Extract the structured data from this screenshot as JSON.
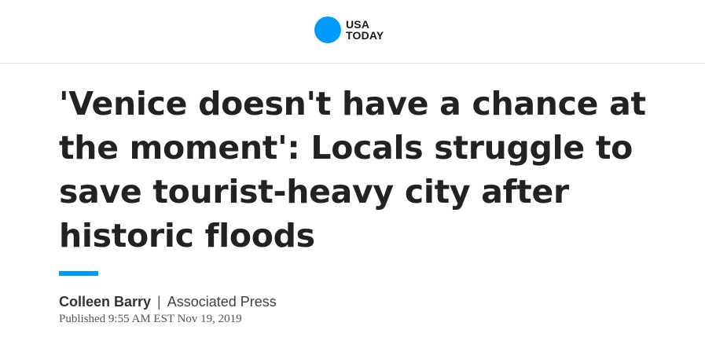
{
  "brand": {
    "name_line1": "USA",
    "name_line2": "TODAY",
    "logo_color": "#009bff",
    "icon": "usa-today-dot-logo"
  },
  "article": {
    "headline": "'Venice doesn't have a chance at the moment': Locals struggle to save tourist-heavy city after historic floods",
    "author": "Colleen Barry",
    "separator": "|",
    "source": "Associated Press",
    "published": "Published 9:55 AM EST Nov 19, 2019",
    "accent_color": "#009bff"
  }
}
